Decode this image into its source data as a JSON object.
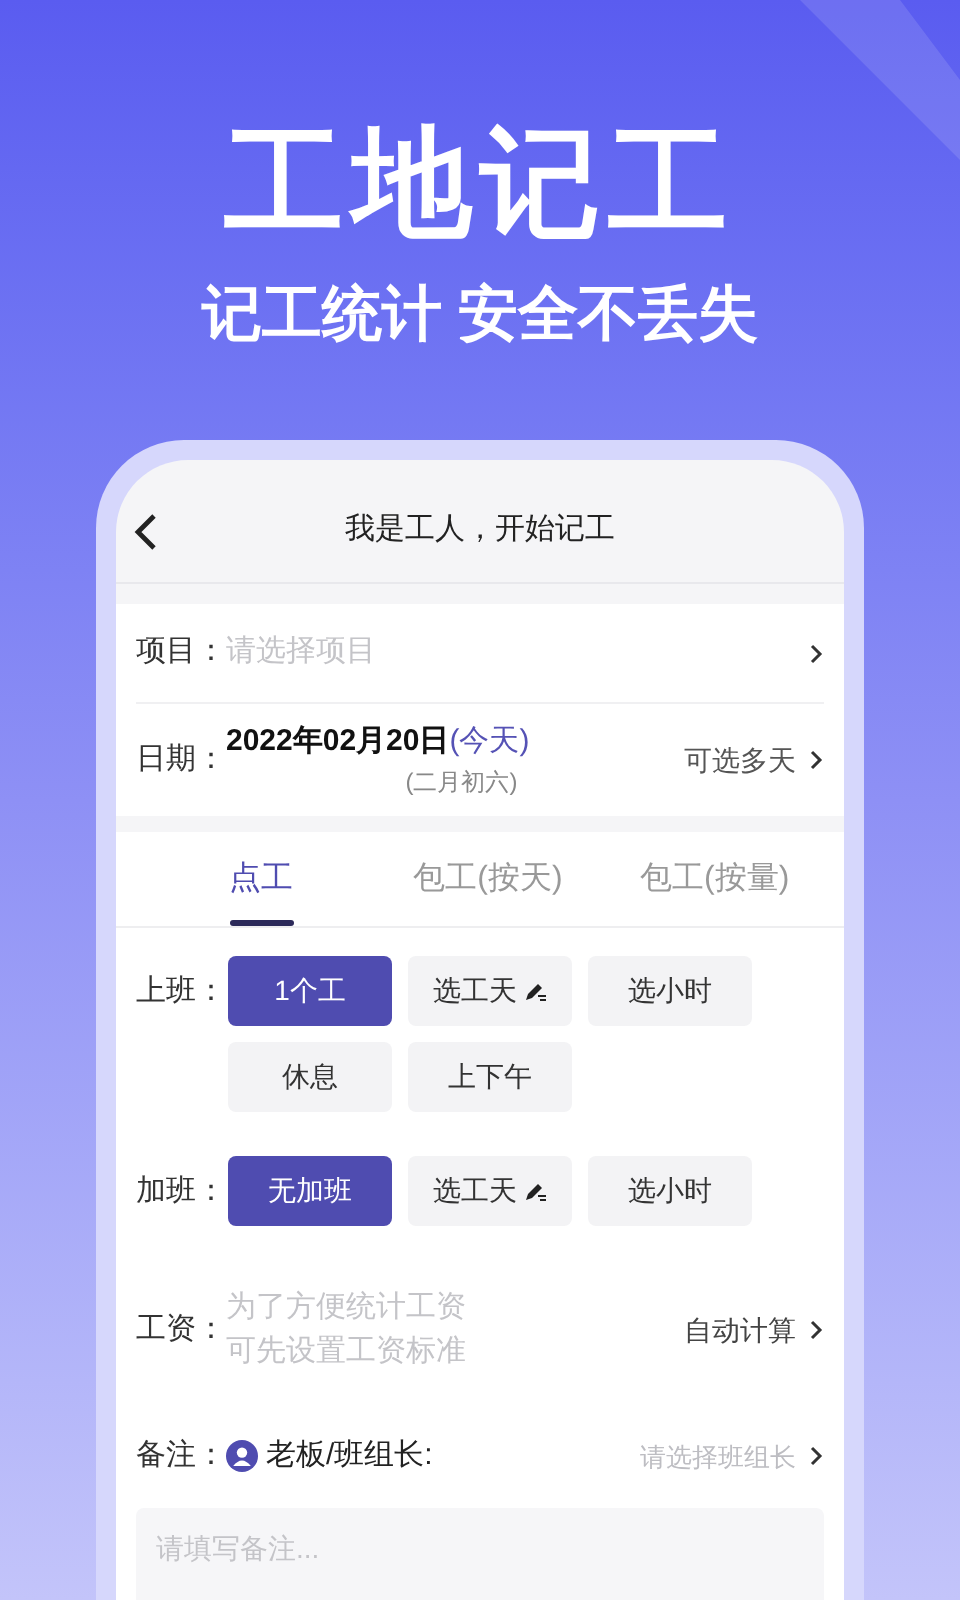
{
  "hero": {
    "title": "工地记工",
    "subtitle": "记工统计 安全不丢失"
  },
  "screen": {
    "title": "我是工人，开始记工",
    "project": {
      "label": "项目：",
      "placeholder": "请选择项目"
    },
    "date": {
      "label": "日期：",
      "value": "2022年02月20日",
      "today": "(今天)",
      "lunar": "(二月初六)",
      "action": "可选多天"
    },
    "tabs": [
      {
        "label": "点工",
        "selected": true
      },
      {
        "label": "包工(按天)",
        "selected": false
      },
      {
        "label": "包工(按量)",
        "selected": false
      }
    ],
    "option_groups": [
      {
        "label": "上班：",
        "options": [
          {
            "label": "1个工",
            "selected": true,
            "editable": false
          },
          {
            "label": "选工天",
            "selected": false,
            "editable": true
          },
          {
            "label": "选小时",
            "selected": false,
            "editable": false
          },
          {
            "label": "休息",
            "selected": false,
            "editable": false
          },
          {
            "label": "上下午",
            "selected": false,
            "editable": false
          }
        ]
      },
      {
        "label": "加班：",
        "options": [
          {
            "label": "无加班",
            "selected": true,
            "editable": false
          },
          {
            "label": "选工天",
            "selected": false,
            "editable": true
          },
          {
            "label": "选小时",
            "selected": false,
            "editable": false
          }
        ]
      }
    ],
    "wage": {
      "label": "工资：",
      "hint_lines": [
        "为了方便统计工资",
        "可先设置工资标准"
      ],
      "action": "自动计算"
    },
    "note": {
      "label": "备注：",
      "boss_label": "老板/班组长:",
      "boss_placeholder": "请选择班组长",
      "placeholder": "请填写备注..."
    }
  }
}
